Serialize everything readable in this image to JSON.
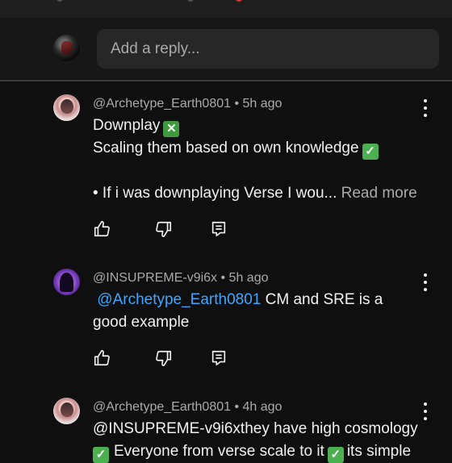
{
  "reply_box": {
    "placeholder": "Add a reply..."
  },
  "comments": [
    {
      "author": "@Archetype_Earth0801",
      "time": "5h ago",
      "lines": [
        "Downplay",
        "Scaling them based on own knowledge",
        "",
        "• If i was downplaying Verse I wou..."
      ],
      "read_more": "Read more",
      "marks": {
        "line1": "cross-mark-icon",
        "line2": "check-mark-icon"
      }
    },
    {
      "author": "@INSUPREME-v9i6x",
      "time": "5h ago",
      "mention": "@Archetype_Earth0801",
      "line1_rest": " CM and SRE is a",
      "line2": "good example"
    },
    {
      "author": "@Archetype_Earth0801",
      "time": "4h ago",
      "line1": "@INSUPREME-v9i6xthey have high cosmology",
      "line2a": "Everyone from verse scale to it",
      "line2b": "its simple"
    }
  ],
  "separator": " • ",
  "colors": {
    "background": "#0f0f0f",
    "reply_area": "#171717",
    "input": "#272727",
    "mention": "#3ea6ff",
    "check": "#4caf50"
  }
}
